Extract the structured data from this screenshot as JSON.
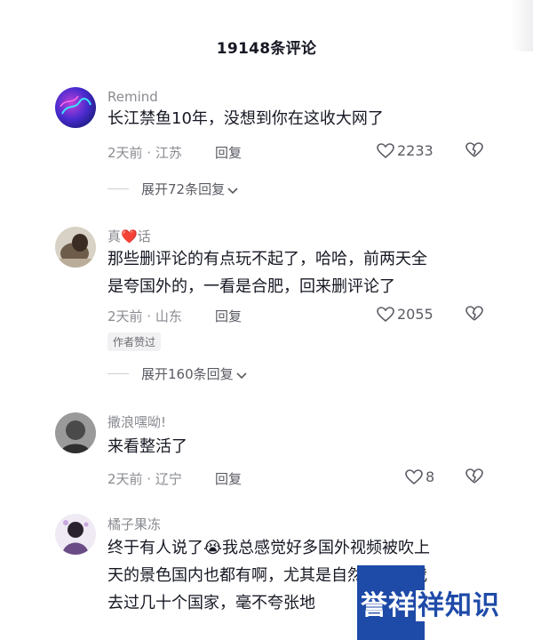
{
  "header": {
    "title": "19148条评论"
  },
  "comments": [
    {
      "username": "Remind",
      "text": "长江禁鱼10年，没想到你在这收大网了",
      "meta": "2天前 · 江苏",
      "reply_label": "回复",
      "likes": "2233",
      "expand_label": "展开72条回复"
    },
    {
      "username_prefix": "真",
      "username_emoji": "❤️",
      "username_suffix": "话",
      "text_line1": "那些删评论的有点玩不起了，哈哈，前两天全",
      "text_line2": "是夸国外的，一看是合肥，回来删评论了",
      "meta": "2天前 · 山东",
      "reply_label": "回复",
      "likes": "2055",
      "badge": "作者赞过",
      "expand_label": "展开160条回复"
    },
    {
      "username": "撒浪嘿呦!",
      "text": "来看整活了",
      "meta": "2天前 · 辽宁",
      "reply_label": "回复",
      "likes": "8"
    },
    {
      "username": "橘子果冻",
      "text_line1_a": "终于有人说了",
      "text_line1_emoji": "😭",
      "text_line1_b": "我总感觉好多国外视频被吹上",
      "text_line2": "天的景色国内也都有啊，尤其是自然景观，我",
      "text_line3": "去过几十个国家，毫不夸张地"
    }
  ],
  "watermark": {
    "text_a": "誉祥",
    "text_b": "祥知识"
  },
  "colors": {
    "primary_text": "#161823",
    "secondary_text": "#8a8b91",
    "heart_red": "#ee2e3b",
    "watermark_blue": "#1e4aa8"
  },
  "icons": {
    "like": "heart-outline-icon",
    "dislike": "broken-heart-icon",
    "expand": "chevron-down-icon"
  }
}
